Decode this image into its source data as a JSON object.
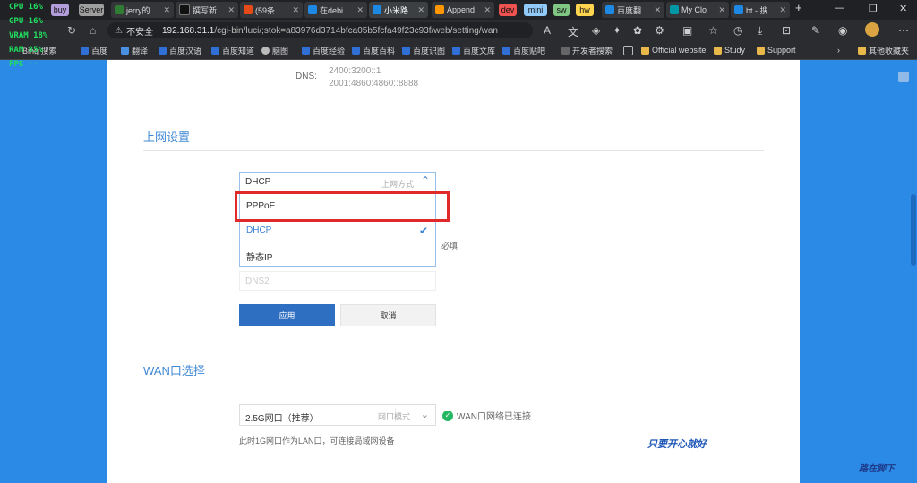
{
  "osd": {
    "cpu": "CPU 16%",
    "gpu": "GPU 16%",
    "vram": "VRAM 18%",
    "ram": "RAM 85%",
    "fps": "FPS --"
  },
  "tabs": [
    {
      "label": "buy",
      "pill": true,
      "color": "#b39ddb"
    },
    {
      "label": "Server",
      "pill": true,
      "color": "#9e9e9e"
    },
    {
      "label": "jerry的",
      "color": "#2e7d32"
    },
    {
      "label": "撰写新",
      "color": "#111111"
    },
    {
      "label": "(59条",
      "color": "#e64a19"
    },
    {
      "label": "在debi",
      "color": "#1e88e5"
    },
    {
      "label": "小米路",
      "active": true,
      "color": "#1e88e5"
    },
    {
      "label": "Append",
      "color": "#ff9800"
    },
    {
      "label": "dev",
      "pill": true,
      "color": "#ef5350"
    },
    {
      "label": "mini",
      "pill": true,
      "color": "#90caf9"
    },
    {
      "label": "sw",
      "pill": true,
      "color": "#81c784"
    },
    {
      "label": "hw",
      "pill": true,
      "color": "#ffd54f"
    },
    {
      "label": "百度翻",
      "color": "#1e88e5"
    },
    {
      "label": "My Clo",
      "color": "#0097a7"
    },
    {
      "label": "bt - 搜",
      "color": "#1e88e5"
    }
  ],
  "new_tab": "+",
  "window_controls": {
    "minimize": "—",
    "restore": "❐",
    "close": "✕"
  },
  "address": {
    "security": "不安全",
    "host": "192.168.31.1",
    "path": "/cgi-bin/luci/;stok=a83976d3714bfca05b5fcfa49f23c93f/web/setting/wan"
  },
  "bookmarks": [
    {
      "label": "Bing 搜索"
    },
    {
      "label": "百度"
    },
    {
      "label": "翻译"
    },
    {
      "label": "百度汉语"
    },
    {
      "label": "百度知道"
    },
    {
      "label": "脑图"
    },
    {
      "label": "百度经验"
    },
    {
      "label": "百度百科"
    },
    {
      "label": "百度识图"
    },
    {
      "label": "百度文库"
    },
    {
      "label": "百度贴吧"
    },
    {
      "label": "开发者搜索"
    },
    {
      "label": "Official website"
    },
    {
      "label": "Study"
    },
    {
      "label": "Support"
    }
  ],
  "bookmarks_more": "›",
  "other_favorites": "其他收藏夹",
  "dns": {
    "label": "DNS:",
    "v1": "2400:3200::1",
    "v2": "2001:4860:4860::8888"
  },
  "section1": "上网设置",
  "conn": {
    "value": "DHCP",
    "hint": "上网方式",
    "options": [
      "PPPoE",
      "DHCP",
      "静态IP"
    ],
    "selected": "DHCP"
  },
  "required": "必填",
  "dns2_placeholder": "DNS2",
  "apply": "应用",
  "cancel": "取消",
  "section2": "WAN口选择",
  "wan": {
    "value": "2.5G网口（推荐）",
    "hint": "网口模式",
    "status": "WAN口网络已连接"
  },
  "note": "此时1G网口作为LAN口，可连接局域网设备",
  "watermark1": "只要开心就好",
  "watermark2": "路在脚下"
}
